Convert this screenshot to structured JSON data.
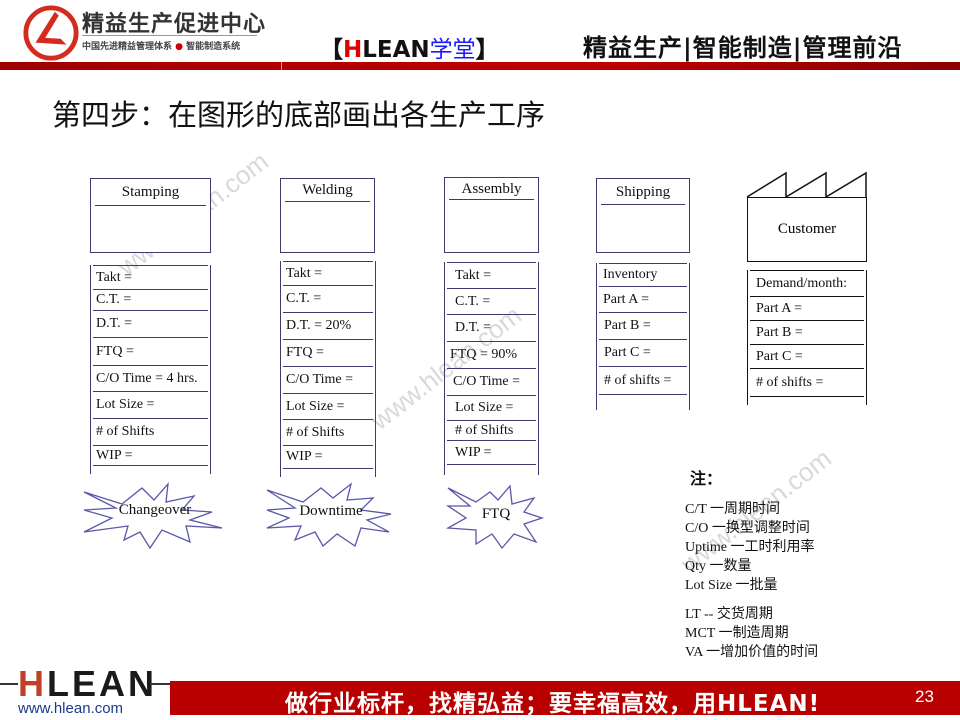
{
  "header": {
    "org_name": "精益生产促进中心",
    "org_subtitle_left": "中国先进精益管理体系",
    "org_subtitle_dot": "●",
    "org_subtitle_right": "智能制造系统",
    "brand_open": "【",
    "brand_h": "H",
    "brand_rest": "LEAN",
    "brand_cn": "学堂",
    "brand_close": "】",
    "slogan": "精益生产|智能制造|管理前沿",
    "accent_color": "#b80000"
  },
  "page_title": "第四步：在图形的底部画出各生产工序",
  "processes": [
    {
      "name": "Stamping",
      "rows": [
        "Takt =",
        "C.T. =",
        "D.T. =",
        "FTQ =",
        "C/O Time = 4 hrs.",
        "Lot Size =",
        "# of Shifts",
        "WIP ="
      ],
      "burst": "Changeover"
    },
    {
      "name": "Welding",
      "rows": [
        "Takt =",
        "C.T. =",
        "D.T. = 20%",
        "FTQ =",
        "C/O Time =",
        "Lot Size =",
        "# of Shifts",
        "WIP ="
      ],
      "burst": "Downtime"
    },
    {
      "name": "Assembly",
      "rows": [
        "Takt =",
        "C.T. =",
        "D.T. =",
        "FTQ = 90%",
        "C/O Time =",
        "Lot Size =",
        "# of Shifts",
        "WIP ="
      ],
      "burst": "FTQ"
    },
    {
      "name": "Shipping",
      "rows": [
        "Inventory",
        "Part A =",
        "Part B =",
        "Part C =",
        "# of shifts ="
      ]
    }
  ],
  "customer": {
    "name": "Customer",
    "rows": [
      "Demand/month:",
      "Part A =",
      "Part B =",
      "Part C =",
      "# of shifts ="
    ]
  },
  "notes": {
    "title": "注：",
    "items": [
      "C/T  一周期时间",
      "C/O  一换型调整时间",
      "Uptime 一工时利用率",
      "Qty   一数量",
      "Lot Size 一批量",
      "LT  --  交货周期",
      "MCT  一制造周期",
      "VA  一增加价值的时间"
    ]
  },
  "watermark": "www.hlean.com",
  "footer": {
    "logo_h": "H",
    "logo_rest": "LEAN",
    "url": "www.hlean.com",
    "slogan": "做行业标杆，找精弘益；要幸福高效，用HLEAN!",
    "page_number": "23"
  }
}
